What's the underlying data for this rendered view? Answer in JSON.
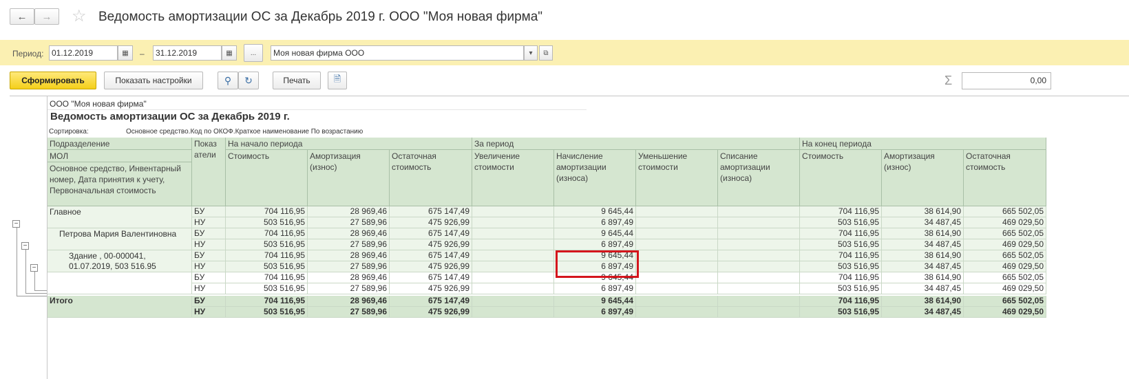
{
  "window": {
    "title": "Ведомость амортизации ОС за Декабрь 2019 г. ООО \"Моя новая фирма\"",
    "back_icon": "arrow-left-icon",
    "forward_icon": "arrow-right-icon",
    "favorite_icon": "star-icon"
  },
  "period": {
    "label": "Период:",
    "from": "01.12.2019",
    "separator": "–",
    "to": "31.12.2019",
    "more_label": "...",
    "org_value": "Моя новая фирма ООО"
  },
  "toolbar": {
    "generate_label": "Сформировать",
    "settings_label": "Показать настройки",
    "print_label": "Печать",
    "sum_symbol": "Σ",
    "sum_value": "0,00"
  },
  "report": {
    "org": "ООО \"Моя новая фирма\"",
    "title": "Ведомость амортизации ОС за Декабрь 2019 г.",
    "sort_label": "Сортировка:",
    "sort_value": "Основное средство.Код по ОКОФ.Краткое наименование По возрастанию",
    "headers": {
      "subdivision": "Подразделение",
      "mol": "МОЛ",
      "asset": "Основное средство, Инвентарный номер, Дата принятия к учету, Первоначальная стоимость",
      "indicators": "Показ атели",
      "group_start": "На начало периода",
      "group_period": "За период",
      "group_end": "На конец периода",
      "cols": [
        "Стоимость",
        "Амортизация (износ)",
        "Остаточная стоимость",
        "Увеличение стоимости",
        "Начисление амортизации (износа)",
        "Уменьшение стоимости",
        "Списание амортизации (износа)",
        "Стоимость",
        "Амортизация (износ)",
        "Остаточная стоимость"
      ]
    },
    "groups": [
      {
        "label": "Главное",
        "rows": [
          {
            "ind": "БУ",
            "v": [
              "704 116,95",
              "28 969,46",
              "675 147,49",
              "",
              "9 645,44",
              "",
              "",
              "704 116,95",
              "38 614,90",
              "665 502,05"
            ]
          },
          {
            "ind": "НУ",
            "v": [
              "503 516,95",
              "27 589,96",
              "475 926,99",
              "",
              "6 897,49",
              "",
              "",
              "503 516,95",
              "34 487,45",
              "469 029,50"
            ]
          }
        ]
      },
      {
        "label": "Петрова Мария Валентиновна",
        "rows": [
          {
            "ind": "БУ",
            "v": [
              "704 116,95",
              "28 969,46",
              "675 147,49",
              "",
              "9 645,44",
              "",
              "",
              "704 116,95",
              "38 614,90",
              "665 502,05"
            ]
          },
          {
            "ind": "НУ",
            "v": [
              "503 516,95",
              "27 589,96",
              "475 926,99",
              "",
              "6 897,49",
              "",
              "",
              "503 516,95",
              "34 487,45",
              "469 029,50"
            ]
          }
        ]
      },
      {
        "label": "Здание , 00-000041, 01.07.2019, 503 516.95",
        "rows": [
          {
            "ind": "БУ",
            "v": [
              "704 116,95",
              "28 969,46",
              "675 147,49",
              "",
              "9 645,44",
              "",
              "",
              "704 116,95",
              "38 614,90",
              "665 502,05"
            ]
          },
          {
            "ind": "НУ",
            "v": [
              "503 516,95",
              "27 589,96",
              "475 926,99",
              "",
              "6 897,49",
              "",
              "",
              "503 516,95",
              "34 487,45",
              "469 029,50"
            ]
          }
        ]
      },
      {
        "label": "",
        "rows": [
          {
            "ind": "БУ",
            "v": [
              "704 116,95",
              "28 969,46",
              "675 147,49",
              "",
              "9 645,44",
              "",
              "",
              "704 116,95",
              "38 614,90",
              "665 502,05"
            ]
          },
          {
            "ind": "НУ",
            "v": [
              "503 516,95",
              "27 589,96",
              "475 926,99",
              "",
              "6 897,49",
              "",
              "",
              "503 516,95",
              "34 487,45",
              "469 029,50"
            ]
          }
        ]
      }
    ],
    "total": {
      "label": "Итого",
      "rows": [
        {
          "ind": "БУ",
          "v": [
            "704 116,95",
            "28 969,46",
            "675 147,49",
            "",
            "9 645,44",
            "",
            "",
            "704 116,95",
            "38 614,90",
            "665 502,05"
          ]
        },
        {
          "ind": "НУ",
          "v": [
            "503 516,95",
            "27 589,96",
            "475 926,99",
            "",
            "6 897,49",
            "",
            "",
            "503 516,95",
            "34 487,45",
            "469 029,50"
          ]
        }
      ]
    },
    "collapse_symbol": "−",
    "colors": {
      "header_bg": "#d5e6d0",
      "total_bg": "#d5e6d0",
      "group_bg": "#edf5ea",
      "highlight": "#d4151c"
    }
  }
}
